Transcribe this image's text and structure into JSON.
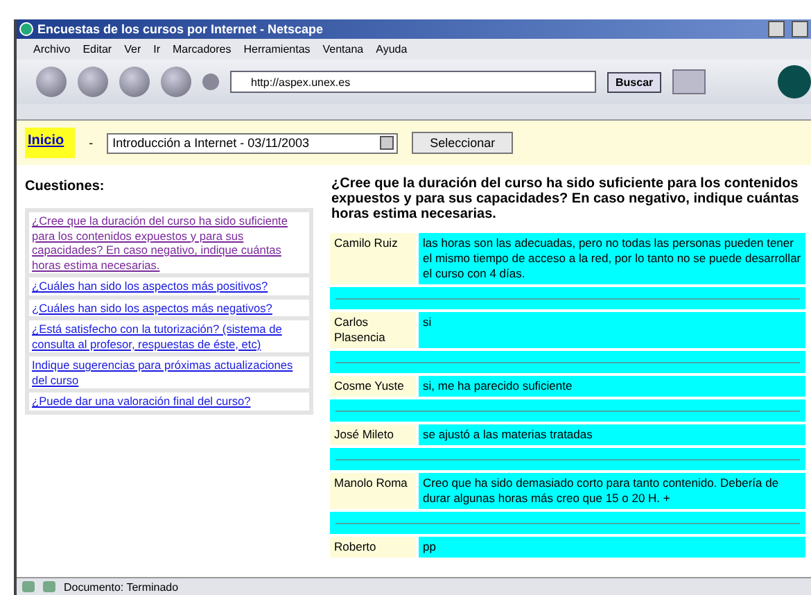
{
  "window": {
    "title": "Encuestas de los cursos por Internet - Netscape"
  },
  "menu": [
    "Archivo",
    "Editar",
    "Ver",
    "Ir",
    "Marcadores",
    "Herramientas",
    "Ventana",
    "Ayuda"
  ],
  "toolbar": {
    "address": "http://aspex.unex.es",
    "search_button": "Buscar"
  },
  "nav": {
    "home_link": "Inicio",
    "separator": "-",
    "course_select": "Introducción a Internet - 03/11/2003",
    "select_button": "Seleccionar"
  },
  "sidebar": {
    "heading": "Cuestiones:",
    "questions": [
      {
        "text": "¿Cree que la duración del curso ha sido suficiente para los contenidos expuestos y para sus capacidades? En caso negativo, indique cuántas horas estima necesarias.",
        "visited": true
      },
      {
        "text": "¿Cuáles han sido los aspectos más positivos?",
        "visited": false
      },
      {
        "text": "¿Cuáles han sido los aspectos más negativos?",
        "visited": false
      },
      {
        "text": "¿Está satisfecho con la tutorización? (sistema de consulta al profesor, respuestas de éste, etc)",
        "visited": false
      },
      {
        "text": "Indique sugerencias para próximas actualizaciones del curso",
        "visited": false
      },
      {
        "text": "¿Puede dar una valoración final del curso?",
        "visited": false
      }
    ]
  },
  "main": {
    "question": "¿Cree que la duración del curso ha sido suficiente para los contenidos expuestos y para sus capacidades? En caso negativo, indique cuántas horas estima necesarias.",
    "answers": [
      {
        "name": "Camilo Ruiz",
        "text": "las horas son las adecuadas, pero no todas las personas pueden tener el mismo tiempo de acceso a la red, por lo tanto no se puede desarrollar el curso con 4 días."
      },
      {
        "name": "Carlos Plasencia",
        "text": "si"
      },
      {
        "name": "Cosme Yuste",
        "text": "si, me ha parecido suficiente"
      },
      {
        "name": "José Mileto",
        "text": "se ajustó a las materias tratadas"
      },
      {
        "name": "Manolo Roma",
        "text": "Creo que ha sido demasiado corto para tanto contenido. Debería de durar algunas horas más creo que 15 o 20 H. +"
      },
      {
        "name": "Roberto",
        "text": "pp"
      }
    ]
  },
  "status_bar": {
    "text": "Documento: Terminado"
  }
}
